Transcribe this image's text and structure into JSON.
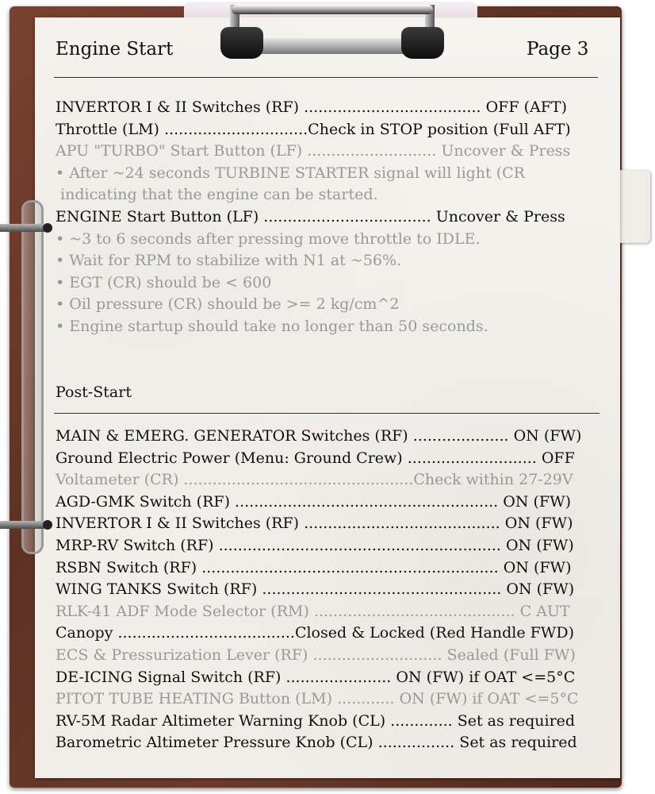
{
  "page": {
    "title": "Engine Start",
    "page_label": "Page 3"
  },
  "engine_start": {
    "lines": [
      {
        "text": "INVERTOR I & II Switches (RF) ..................................... OFF (AFT)",
        "dim": false
      },
      {
        "text": "Throttle (LM) ..............................Check in STOP position (Full AFT)",
        "dim": false
      },
      {
        "text": "APU \"TURBO\" Start Button (LF) ........................... Uncover & Press",
        "dim": true
      },
      {
        "text": "• After ~24 seconds TURBINE STARTER signal will light (CR",
        "dim": true
      },
      {
        "text": " indicating that the engine can be started.",
        "dim": true
      },
      {
        "text": "ENGINE Start Button (LF) ................................... Uncover & Press",
        "dim": false
      },
      {
        "text": "• ~3 to 6 seconds after pressing move throttle to IDLE.",
        "dim": true
      },
      {
        "text": "• Wait for RPM to stabilize with N1 at ~56%.",
        "dim": true
      },
      {
        "text": "• EGT (CR) should be < 600",
        "dim": true
      },
      {
        "text": "• Oil pressure (CR) should be >= 2 kg/cm^2",
        "dim": true
      },
      {
        "text": "• Engine startup should take no longer than 50 seconds.",
        "dim": true
      }
    ]
  },
  "post_start": {
    "heading": "Post-Start",
    "lines": [
      {
        "text": "MAIN & EMERG. GENERATOR Switches (RF) .................... ON (FW)",
        "dim": false
      },
      {
        "text": "Ground Electric Power (Menu: Ground Crew) ........................... OFF",
        "dim": false
      },
      {
        "text": "Voltameter (CR) ................................................Check within 27-29V",
        "dim": true
      },
      {
        "text": "AGD-GMK Switch (RF) ....................................................... ON (FW)",
        "dim": false
      },
      {
        "text": "INVERTOR I & II Switches (RF) ......................................... ON (FW)",
        "dim": false
      },
      {
        "text": "MRP-RV Switch (RF) ........................................................... ON (FW)",
        "dim": false
      },
      {
        "text": "RSBN Switch (RF) .............................................................. ON (FW)",
        "dim": false
      },
      {
        "text": "WING TANKS Switch (RF) .................................................. ON (FW)",
        "dim": false
      },
      {
        "text": "RLK-41 ADF Mode Selector (RM) .......................................... C AUT",
        "dim": true
      },
      {
        "text": "Canopy .....................................Closed & Locked (Red Handle FWD)",
        "dim": false
      },
      {
        "text": "ECS & Pressurization Lever (RF) ........................... Sealed (Full FW)",
        "dim": true
      },
      {
        "text": "DE-ICING Signal Switch (RF) ...................... ON (FW) if OAT <=5°C",
        "dim": false
      },
      {
        "text": "PITOT TUBE HEATING Button (LM) ............ ON (FW) if OAT <=5°C",
        "dim": true
      },
      {
        "text": "RV-5M Radar Altimeter Warning Knob (CL) ............. Set as required",
        "dim": false
      },
      {
        "text": "Barometric Altimeter Pressure Knob (CL) ................ Set as required",
        "dim": false
      }
    ]
  }
}
